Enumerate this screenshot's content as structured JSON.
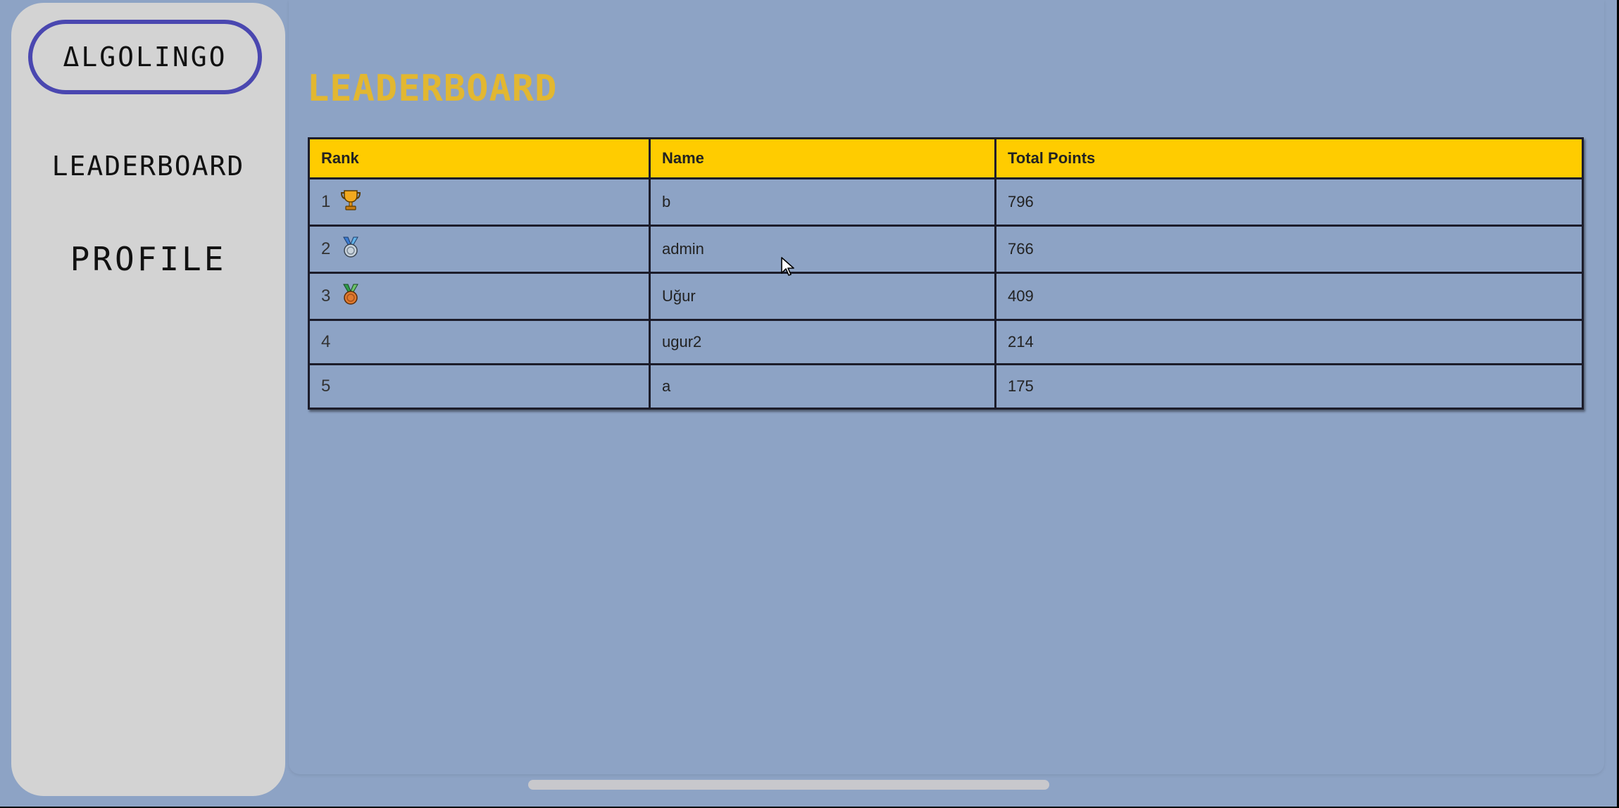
{
  "sidebar": {
    "brand": "ΔLGOLINGO",
    "nav": {
      "leaderboard": "LEADERBOARD",
      "profile": "PROFILE"
    }
  },
  "main": {
    "title": "LEADERBOARD",
    "table": {
      "headers": {
        "rank": "Rank",
        "name": "Name",
        "points": "Total Points"
      },
      "rows": [
        {
          "rank": "1",
          "icon": "trophy-icon",
          "name": "b",
          "points": "796"
        },
        {
          "rank": "2",
          "icon": "silver-medal-icon",
          "name": "admin",
          "points": "766"
        },
        {
          "rank": "3",
          "icon": "bronze-medal-icon",
          "name": "Uğur",
          "points": "409"
        },
        {
          "rank": "4",
          "icon": "",
          "name": "ugur2",
          "points": "214"
        },
        {
          "rank": "5",
          "icon": "",
          "name": "a",
          "points": "175"
        }
      ]
    }
  },
  "colors": {
    "background": "#8da3c5",
    "sidebar": "#d3d3d3",
    "brand_border": "#4a47b0",
    "title": "#e2b731",
    "header_fill": "#ffcc00"
  }
}
